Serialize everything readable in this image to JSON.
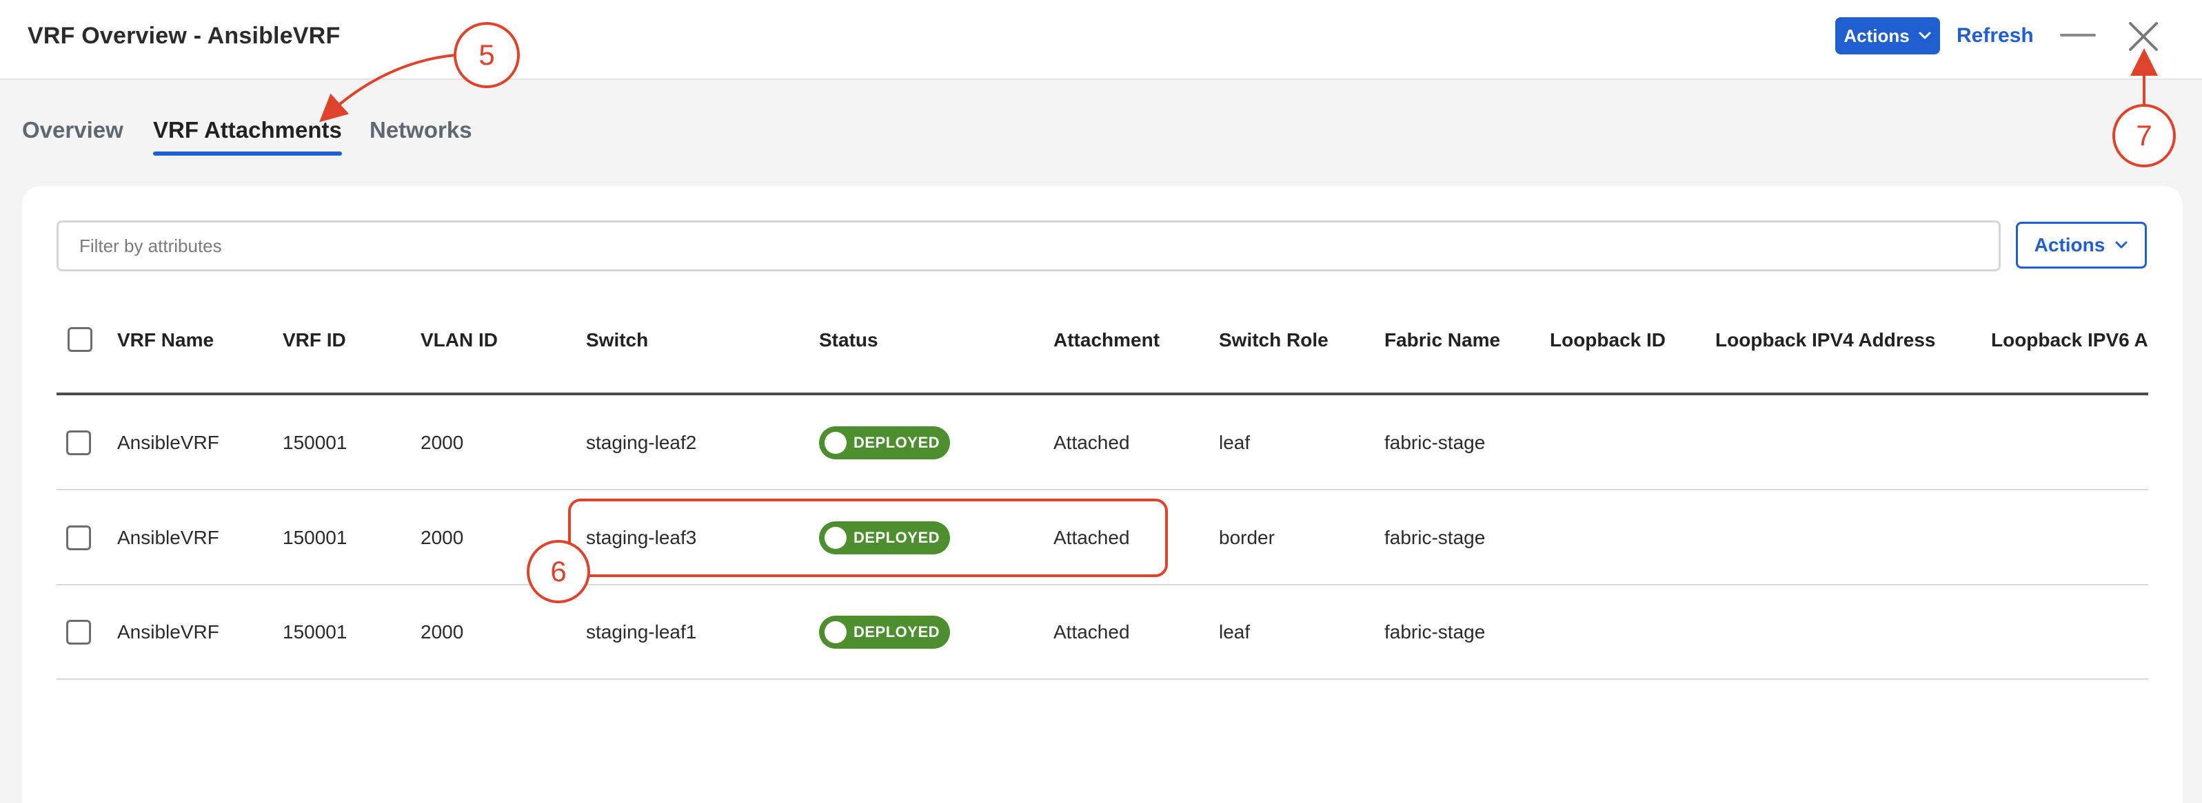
{
  "header": {
    "title": "VRF Overview - AnsibleVRF",
    "actions_label": "Actions",
    "refresh_label": "Refresh",
    "minimize_icon": "minimize-icon",
    "close_icon": "close-icon"
  },
  "tabs": [
    {
      "label": "Overview",
      "active": false
    },
    {
      "label": "VRF Attachments",
      "active": true
    },
    {
      "label": "Networks",
      "active": false
    }
  ],
  "toolbar": {
    "filter_placeholder": "Filter by attributes",
    "actions_label": "Actions"
  },
  "table": {
    "columns": [
      "VRF Name",
      "VRF ID",
      "VLAN ID",
      "Switch",
      "Status",
      "Attachment",
      "Switch Role",
      "Fabric Name",
      "Loopback ID",
      "Loopback IPV4 Address",
      "Loopback IPV6 A"
    ],
    "rows": [
      {
        "vrf_name": "AnsibleVRF",
        "vrf_id": "150001",
        "vlan_id": "2000",
        "switch": "staging-leaf2",
        "status": "DEPLOYED",
        "attachment": "Attached",
        "switch_role": "leaf",
        "fabric_name": "fabric-stage"
      },
      {
        "vrf_name": "AnsibleVRF",
        "vrf_id": "150001",
        "vlan_id": "2000",
        "switch": "staging-leaf3",
        "status": "DEPLOYED",
        "attachment": "Attached",
        "switch_role": "border",
        "fabric_name": "fabric-stage"
      },
      {
        "vrf_name": "AnsibleVRF",
        "vrf_id": "150001",
        "vlan_id": "2000",
        "switch": "staging-leaf1",
        "status": "DEPLOYED",
        "attachment": "Attached",
        "switch_role": "leaf",
        "fabric_name": "fabric-stage"
      }
    ]
  },
  "annotations": {
    "callout_5": "5",
    "callout_6": "6",
    "callout_7": "7"
  },
  "colors": {
    "primary": "#1f5fd0",
    "deployed": "#4d8f2e",
    "annotation": "#e0432b"
  }
}
